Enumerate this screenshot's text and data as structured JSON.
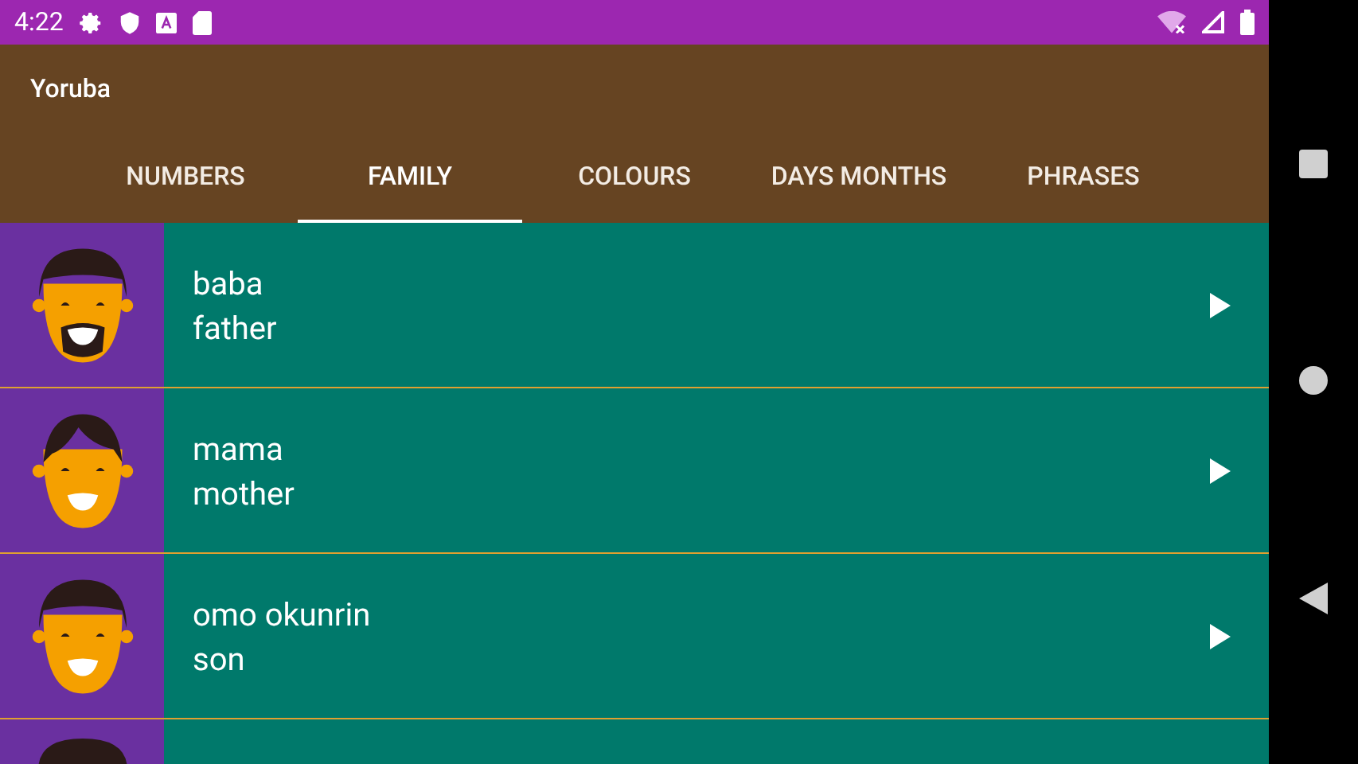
{
  "status_bar": {
    "time": "4:22"
  },
  "app_bar": {
    "title": "Yoruba"
  },
  "tabs": [
    {
      "label": "NUMBERS",
      "selected": false
    },
    {
      "label": "FAMILY",
      "selected": true
    },
    {
      "label": "COLOURS",
      "selected": false
    },
    {
      "label": "DAYS MONTHS",
      "selected": false
    },
    {
      "label": "PHRASES",
      "selected": false
    }
  ],
  "words": [
    {
      "yoruba": "baba",
      "english": "father",
      "kind": "beard"
    },
    {
      "yoruba": "mama",
      "english": "mother",
      "kind": "woman"
    },
    {
      "yoruba": "omo okunrin",
      "english": "son",
      "kind": "boy"
    }
  ]
}
